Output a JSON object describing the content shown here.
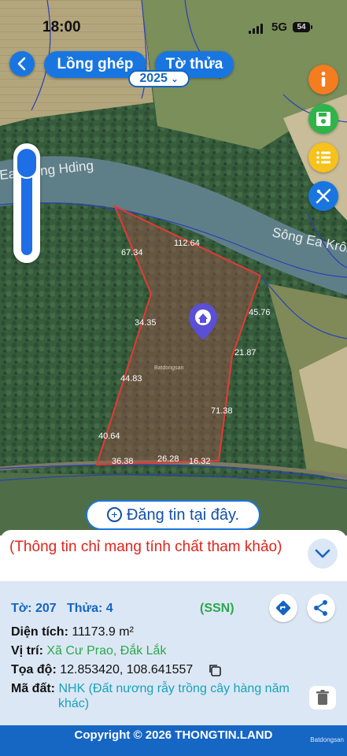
{
  "status_bar": {
    "time": "18:00",
    "network": "5G",
    "battery": "54"
  },
  "header": {
    "layer_button": "Lồng ghép",
    "parcel_button": "Tờ thửa"
  },
  "map": {
    "river_label_1": "Ea Krông Hding",
    "river_label_2": "Sông Ea Krôn",
    "edge_lengths": [
      "112.64",
      "67.34",
      "45.76",
      "34.35",
      "21.87",
      "44.83",
      "71.38",
      "40.64",
      "36.38",
      "26.28",
      "16.32"
    ],
    "watermark": "Batdongsan"
  },
  "post_button": "Đăng tin tại đây.",
  "notice": "(Thông tin chỉ mang tính chất tham khảo)",
  "parcel": {
    "sheet_label": "Tờ:",
    "sheet_value": "207",
    "plot_label": "Thửa:",
    "plot_value": "4",
    "year": "2025",
    "source": "(SSN)",
    "area_label": "Diện tích:",
    "area_value": "11173.9 m²",
    "location_label": "Vị trí:",
    "location_value": "Xã Cư Prao, Đắk Lắk",
    "coords_label": "Tọa độ:",
    "coords_value": "12.853420, 108.641557",
    "landuse_label": "Mã đất:",
    "landuse_value_line1": "NHK (Đất nương rẫy trồng cây hàng năm",
    "landuse_value_line2": "khác)"
  },
  "footer": {
    "copyright": "Copyright © 2026 THONGTIN.LAND",
    "watermark": "Batdongsan"
  },
  "colors": {
    "primary": "#1976e0",
    "boundary": "#e53935",
    "info_bg": "#dce7f5",
    "footer": "#1666c4"
  }
}
